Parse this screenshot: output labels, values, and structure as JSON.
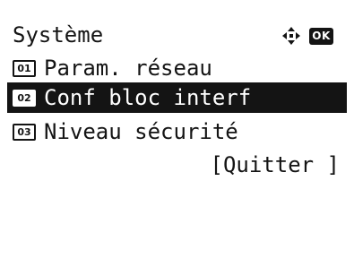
{
  "header": {
    "title": "Système",
    "nav_icon": "four-way-arrow-icon",
    "ok_label": "OK"
  },
  "menu": {
    "items": [
      {
        "number": "01",
        "label": "Param. réseau",
        "selected": false
      },
      {
        "number": "02",
        "label": "Conf bloc interf",
        "selected": true
      },
      {
        "number": "03",
        "label": "Niveau sécurité",
        "selected": false
      }
    ]
  },
  "footer": {
    "quit_label": "[Quitter ]"
  }
}
